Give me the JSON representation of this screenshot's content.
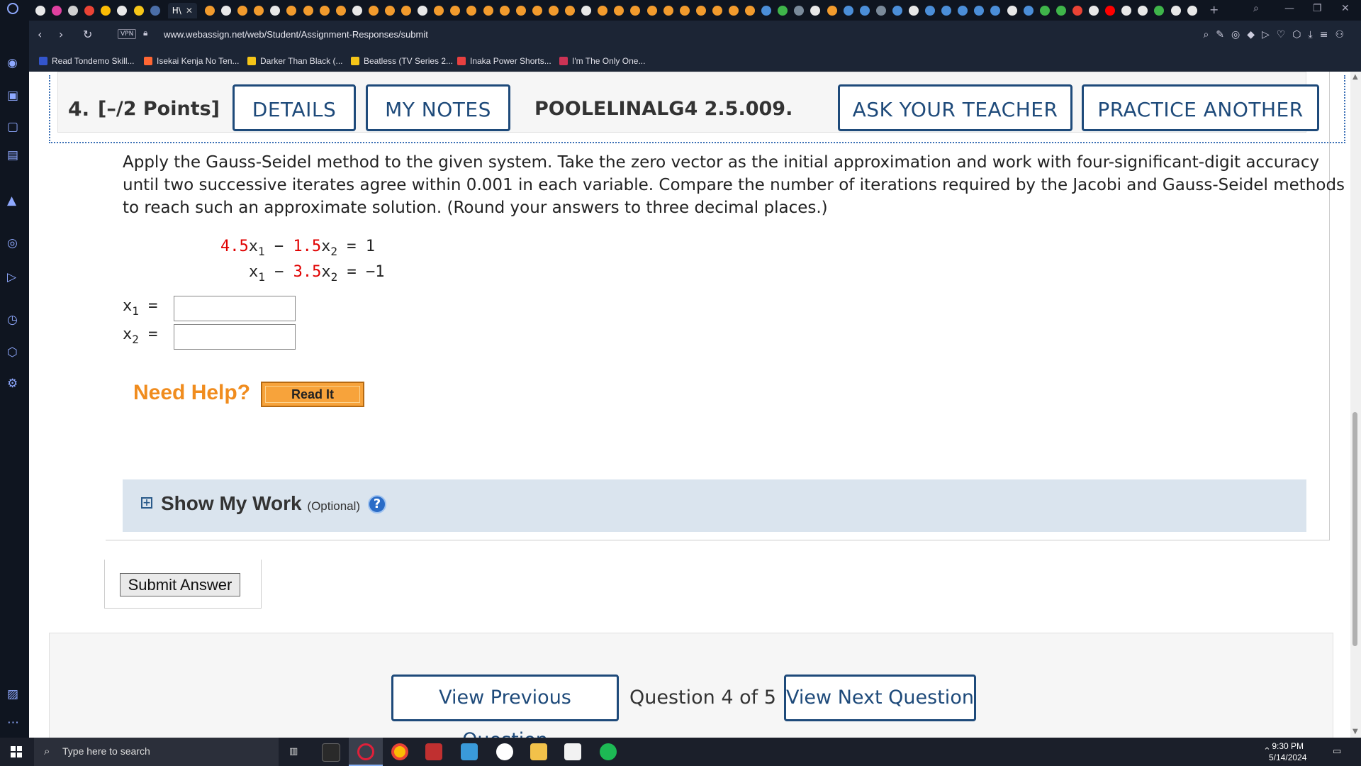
{
  "browser": {
    "active_tab_title": "H\\",
    "url": "www.webassign.net/web/Student/Assignment-Responses/submit",
    "vpn_label": "VPN",
    "bookmarks": [
      {
        "label": "Read Tondemo Skill...",
        "color": "#3355cc"
      },
      {
        "label": "Isekai Kenja No Ten...",
        "color": "#ff6633"
      },
      {
        "label": "Darker Than Black (...",
        "color": "#f5c518"
      },
      {
        "label": "Beatless (TV Series 2...",
        "color": "#f5c518"
      },
      {
        "label": "Inaka Power Shorts...",
        "color": "#e84040"
      },
      {
        "label": "I'm The Only One...",
        "color": "#cc3355"
      }
    ]
  },
  "question": {
    "number": "4.",
    "points": "[–/2 Points]",
    "details_label": "DETAILS",
    "notes_label": "MY NOTES",
    "code": "POOLELINALG4 2.5.009.",
    "ask_label": "ASK YOUR TEACHER",
    "practice_label": "PRACTICE ANOTHER",
    "prompt": "Apply the Gauss-Seidel method to the given system. Take the zero vector as the initial approximation and work with four-significant-digit accuracy until two successive iterates agree within 0.001 in each variable. Compare the number of iterations required by the Jacobi and Gauss-Seidel methods to reach such an approximate solution. (Round your answers to three decimal places.)",
    "equations": [
      {
        "c1": "4.5",
        "v1": "x",
        "s1": "1",
        "op": "−",
        "c2": "1.5",
        "v2": "x",
        "s2": "2",
        "eq": "=",
        "rhs": "1"
      },
      {
        "c1": "",
        "v1": "x",
        "s1": "1",
        "op": "−",
        "c2": "3.5",
        "v2": "x",
        "s2": "2",
        "eq": "=",
        "rhs": "−1"
      }
    ],
    "answers": [
      {
        "var": "x",
        "sub": "1",
        "eq": "=",
        "value": ""
      },
      {
        "var": "x",
        "sub": "2",
        "eq": "=",
        "value": ""
      }
    ],
    "need_help": "Need Help?",
    "read_it": "Read It",
    "show_work": "Show My Work",
    "show_work_optional": "(Optional)",
    "help_mark": "?",
    "submit_label": "Submit Answer"
  },
  "navigation": {
    "previous": "View Previous Question",
    "counter": "Question 4 of 5",
    "next": "View Next Question"
  },
  "taskbar": {
    "search_placeholder": "Type here to search",
    "time": "9:30 PM",
    "date": "5/14/2024"
  },
  "colors": {
    "accent_blue": "#1e4a7a",
    "coefficient_red": "#e00000",
    "need_help_orange": "#f08c1e",
    "show_work_bg": "#dae4ee"
  }
}
